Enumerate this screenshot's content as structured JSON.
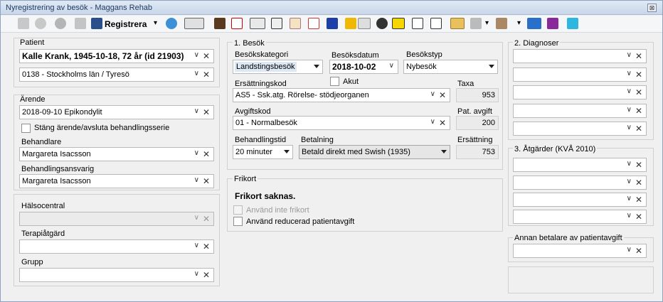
{
  "window": {
    "title": "Nyregistrering av besök  - Maggans Rehab",
    "close_glyph": "⊠"
  },
  "toolbar": {
    "register_label": "Registrera",
    "more_glyph": "▾"
  },
  "patient": {
    "section": "Patient",
    "name": "Kalle Krank, 1945-10-18, 72 år (id 21903)",
    "region": "0138 - Stockholms län / Tyresö"
  },
  "arende": {
    "section": "Ärende",
    "value": "2018-09-10 Epikondylit",
    "close_checkbox_label": "Stäng ärende/avsluta behandlingsserie",
    "behandlare_label": "Behandlare",
    "behandlare": "Margareta Isacsson",
    "ansvarig_label": "Behandlingsansvarig",
    "ansvarig": "Margareta Isacsson"
  },
  "lower_left": {
    "halsocentral_label": "Hälsocentral",
    "halsocentral": "",
    "terapi_label": "Terapiåtgärd",
    "terapi": "",
    "grupp_label": "Grupp",
    "grupp": ""
  },
  "besok": {
    "section": "1. Besök",
    "kategori_label": "Besökskategori",
    "kategori": "Landstingsbesök",
    "datum_label": "Besöksdatum",
    "datum": "2018-10-02",
    "typ_label": "Besökstyp",
    "typ": "Nybesök",
    "akut_label": "Akut",
    "ersattningskod_label": "Ersättningskod",
    "ersattningskod": "AS5 - Ssk.atg. Rörelse- stödjeorganen",
    "taxa_label": "Taxa",
    "taxa": "953",
    "avgiftskod_label": "Avgiftskod",
    "avgiftskod": "01 - Normalbesök",
    "pat_avgift_label": "Pat. avgift",
    "pat_avgift": "200",
    "behandlingstid_label": "Behandlingstid",
    "behandlingstid": "20 minuter",
    "betalning_label": "Betalning",
    "betalning": "Betald direkt med Swish (1935)",
    "ersattning_label": "Ersättning",
    "ersattning": "753"
  },
  "frikort": {
    "section": "Frikort",
    "status": "Frikort saknas.",
    "option1": "Använd inte frikort",
    "option2": "Använd reducerad patientavgift"
  },
  "diagnoser": {
    "section": "2. Diagnoser"
  },
  "atgarder": {
    "section": "3. Åtgärder (KVÅ 2010)"
  },
  "annan": {
    "section": "Annan betalare av patientavgift"
  },
  "glyphs": {
    "chevron": "∨",
    "clear": "✕"
  }
}
